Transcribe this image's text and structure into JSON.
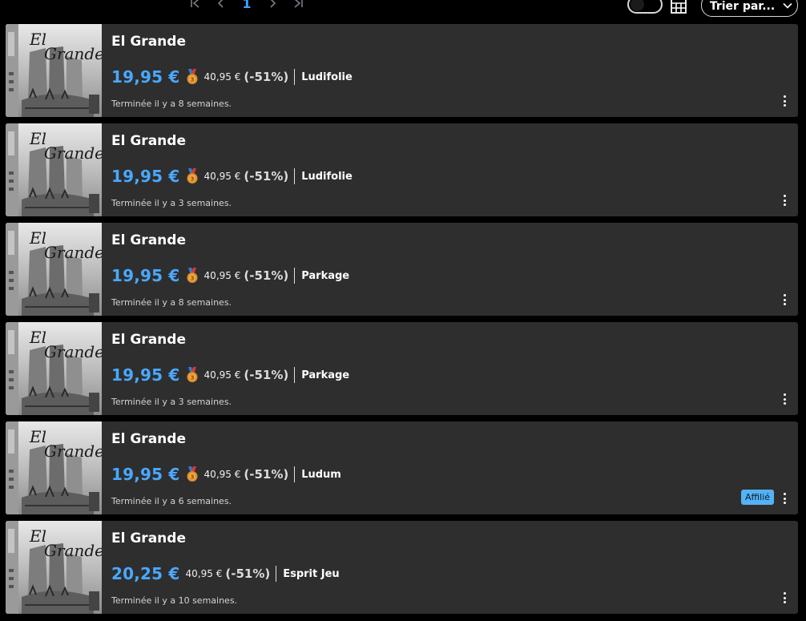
{
  "pagination": {
    "first_icon": "first-page-icon",
    "prev_icon": "prev-page-icon",
    "current_page": "1",
    "next_icon": "next-page-icon",
    "last_icon": "last-page-icon"
  },
  "toolbar": {
    "toggle_state": "off",
    "grid_icon": "grid-view-icon",
    "sort_label": "Trier par...",
    "sort_icon": "chevron-down-icon"
  },
  "colors": {
    "accent": "#3aa6ff",
    "price": "#4aa8ff",
    "card_bg": "#2e2e2e",
    "badge_bg": "#55b3f5",
    "medal": "#e0902c"
  },
  "offers": [
    {
      "title": "El Grande",
      "price": "19,95 €",
      "medal": true,
      "old_price": "40,95 €",
      "discount": "(-51%)",
      "shop": "Ludifolie",
      "ended": "Terminée il y a 8 semaines.",
      "badge": null
    },
    {
      "title": "El Grande",
      "price": "19,95 €",
      "medal": true,
      "old_price": "40,95 €",
      "discount": "(-51%)",
      "shop": "Ludifolie",
      "ended": "Terminée il y a 3 semaines.",
      "badge": null
    },
    {
      "title": "El Grande",
      "price": "19,95 €",
      "medal": true,
      "old_price": "40,95 €",
      "discount": "(-51%)",
      "shop": "Parkage",
      "ended": "Terminée il y a 8 semaines.",
      "badge": null
    },
    {
      "title": "El Grande",
      "price": "19,95 €",
      "medal": true,
      "old_price": "40,95 €",
      "discount": "(-51%)",
      "shop": "Parkage",
      "ended": "Terminée il y a 3 semaines.",
      "badge": null
    },
    {
      "title": "El Grande",
      "price": "19,95 €",
      "medal": true,
      "old_price": "40,95 €",
      "discount": "(-51%)",
      "shop": "Ludum",
      "ended": "Terminée il y a 6 semaines.",
      "badge": "Affilié"
    },
    {
      "title": "El Grande",
      "price": "20,25 €",
      "medal": false,
      "old_price": "40,95 €",
      "discount": "(-51%)",
      "shop": "Esprit Jeu",
      "ended": "Terminée il y a 10 semaines.",
      "badge": null
    }
  ],
  "icons": {
    "medal": "medal-icon",
    "more": "more-vertical-icon",
    "thumbnail": "el-grande-box-cover"
  }
}
